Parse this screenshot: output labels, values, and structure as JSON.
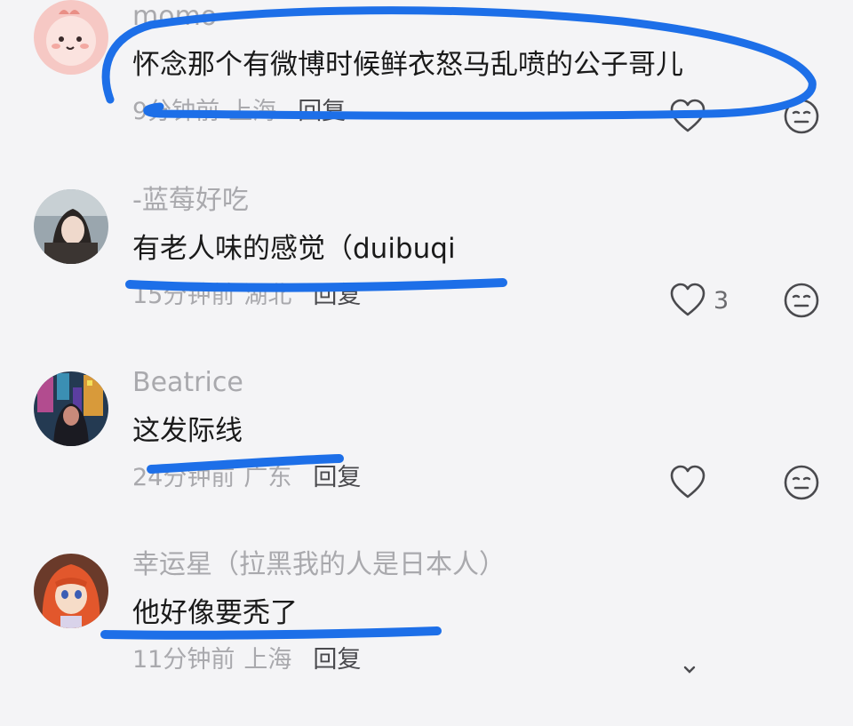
{
  "comments": [
    {
      "username": "momo",
      "content": "怀念那个有微博时候鲜衣怒马乱喷的公子哥儿",
      "time": "9分钟前",
      "location": "上海",
      "reply": "回复",
      "likes": ""
    },
    {
      "username": "-蓝莓好吃",
      "content": "有老人味的感觉（duibuqi",
      "time": "15分钟前",
      "location": "湖北",
      "reply": "回复",
      "likes": "3"
    },
    {
      "username": "Beatrice",
      "content": "这发际线",
      "time": "24分钟前",
      "location": "广东",
      "reply": "回复",
      "likes": ""
    },
    {
      "username": "幸运星（拉黑我的人是日本人）",
      "content": "他好像要秃了",
      "time": "11分钟前",
      "location": "上海",
      "reply": "回复",
      "likes": ""
    }
  ],
  "colors": {
    "annotation": "#1d6fe8",
    "meta": "#a9a9ad",
    "text": "#1a1a1a"
  },
  "icons": [
    "heart-icon",
    "neutral-face-icon",
    "chevron-down-icon"
  ]
}
